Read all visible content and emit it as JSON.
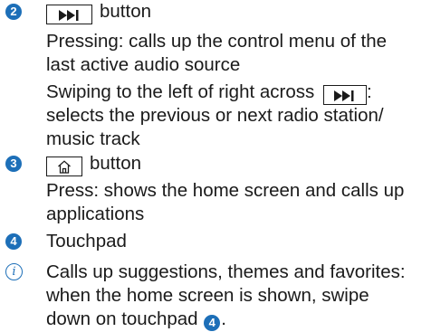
{
  "colors": {
    "accent": "#1d6fb8",
    "text": "#1a1a1a"
  },
  "items": [
    {
      "number": "2",
      "icon": "skip-next-icon",
      "title": "button",
      "lines": [
        "Pressing: calls up the control menu of the",
        "last active audio source",
        "Swiping to the left of right across",
        ":",
        "selects the previous or next radio station/",
        "music track"
      ]
    },
    {
      "number": "3",
      "icon": "home-icon",
      "title": "button",
      "lines": [
        "Press: shows the home screen and calls up",
        "applications"
      ]
    },
    {
      "number": "4",
      "title": "Touchpad"
    }
  ],
  "note": {
    "icon": "info-icon",
    "lines": [
      "Calls up suggestions, themes and favorites:",
      "when the home screen is shown, swipe",
      "down on touchpad",
      "4",
      "."
    ]
  }
}
